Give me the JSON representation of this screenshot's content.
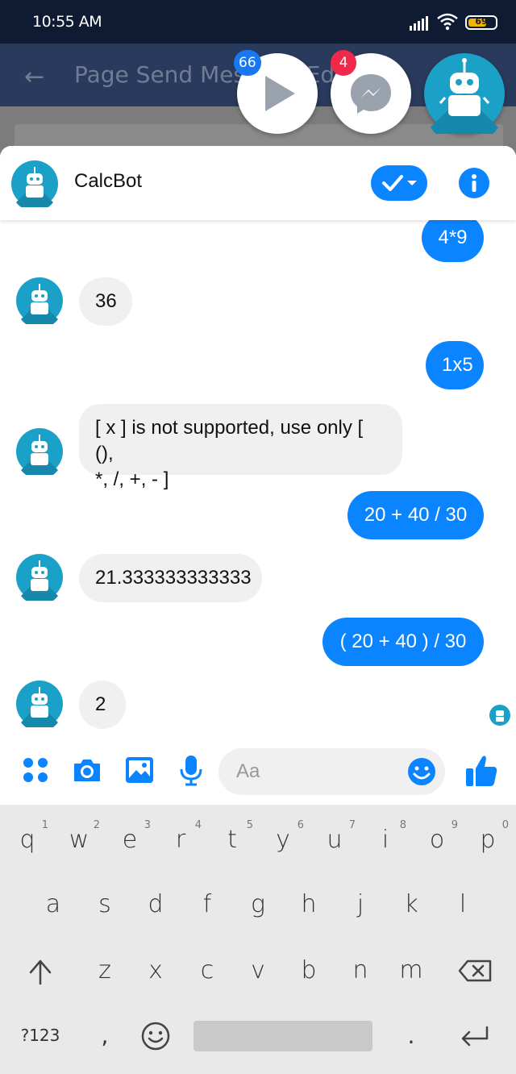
{
  "status_bar": {
    "time": "10:55 AM",
    "battery": "69"
  },
  "background_app": {
    "title": "Page Send Message Editor"
  },
  "chat_heads": [
    {
      "name": "play-app",
      "badge": "66",
      "badge_color": "#1877f2"
    },
    {
      "name": "messenger",
      "badge": "4",
      "badge_color": "#f02849"
    },
    {
      "name": "calcbot"
    }
  ],
  "chat": {
    "contact_name": "CalcBot",
    "messages": [
      {
        "from": "me",
        "text": "4*9"
      },
      {
        "from": "bot",
        "text": "36"
      },
      {
        "from": "me",
        "text": "1x5"
      },
      {
        "from": "bot",
        "text": "[ x ] is not supported, use only [ (),\n*, /, +, - ]"
      },
      {
        "from": "me",
        "text": "20 + 40 / 30"
      },
      {
        "from": "bot",
        "text": "21.333333333333"
      },
      {
        "from": "me",
        "text": "( 20 + 40 ) / 30"
      },
      {
        "from": "bot",
        "text": "2"
      }
    ]
  },
  "composer": {
    "placeholder": "Aa"
  },
  "colors": {
    "accent": "#0a84ff",
    "bubble_in": "#f0f0f0",
    "bot_teal": "#1ba1c7"
  },
  "keyboard": {
    "row1": [
      {
        "key": "q",
        "hint": "1"
      },
      {
        "key": "w",
        "hint": "2"
      },
      {
        "key": "e",
        "hint": "3"
      },
      {
        "key": "r",
        "hint": "4"
      },
      {
        "key": "t",
        "hint": "5"
      },
      {
        "key": "y",
        "hint": "6"
      },
      {
        "key": "u",
        "hint": "7"
      },
      {
        "key": "i",
        "hint": "8"
      },
      {
        "key": "o",
        "hint": "9"
      },
      {
        "key": "p",
        "hint": "0"
      }
    ],
    "row2": [
      "a",
      "s",
      "d",
      "f",
      "g",
      "h",
      "j",
      "k",
      "l"
    ],
    "row3": [
      "z",
      "x",
      "c",
      "v",
      "b",
      "n",
      "m"
    ],
    "symbols_label": "?123",
    "comma": ",",
    "period": "."
  }
}
